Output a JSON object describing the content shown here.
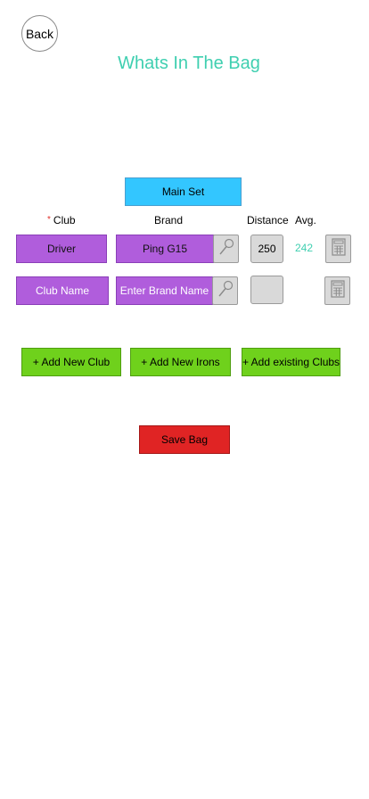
{
  "header": {
    "back_label": "Back",
    "title": "Whats In The Bag"
  },
  "set_button": "Main Set",
  "columns": {
    "required_mark": "*",
    "club": "Club",
    "brand": "Brand",
    "distance": "Distance",
    "avg": "Avg."
  },
  "rows": [
    {
      "club": "Driver",
      "brand": "Ping G15",
      "distance": "250",
      "avg": "242"
    },
    {
      "club": "Club Name",
      "brand": "Enter Brand Name",
      "distance": "",
      "avg": ""
    }
  ],
  "actions": {
    "add_new_club": "+ Add New Club",
    "add_new_irons": "+ Add New Irons",
    "add_existing_clubs": "+ Add existing Clubs",
    "save_bag": "Save Bag"
  },
  "colors": {
    "title": "#3fcfb0",
    "set_button": "#33c6ff",
    "club_field": "#b05ddc",
    "add_button": "#6fd11c",
    "save_button": "#e02424"
  },
  "icons": [
    "search-icon",
    "calculator-icon"
  ]
}
